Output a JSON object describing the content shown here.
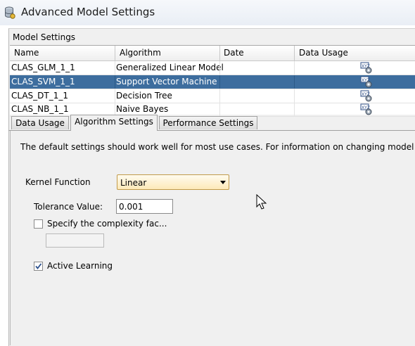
{
  "window": {
    "title": "Advanced Model Settings"
  },
  "model_settings": {
    "section_title": "Model Settings",
    "columns": [
      "Name",
      "Algorithm",
      "Date",
      "Data Usage"
    ],
    "rows": [
      {
        "name": "CLAS_GLM_1_1",
        "algorithm": "Generalized Linear Model",
        "date": "",
        "selected": false
      },
      {
        "name": "CLAS_SVM_1_1",
        "algorithm": "Support Vector Machine",
        "date": "",
        "selected": true
      },
      {
        "name": "CLAS_DT_1_1",
        "algorithm": "Decision Tree",
        "date": "",
        "selected": false
      },
      {
        "name": "CLAS_NB_1_1",
        "algorithm": "Naive Bayes",
        "date": "",
        "selected": false
      }
    ],
    "data_usage_icon": "data-usage-xyz-gear-icon"
  },
  "tabs": [
    {
      "label": "Data Usage",
      "active": false
    },
    {
      "label": "Algorithm Settings",
      "active": true
    },
    {
      "label": "Performance Settings",
      "active": false
    }
  ],
  "algorithm_settings": {
    "info_text": "The default settings should work well for most use cases. For information on changing model algo",
    "kernel_function_label": "Kernel Function",
    "kernel_function_value": "Linear",
    "tolerance_label": "Tolerance Value:",
    "tolerance_value": "0.001",
    "complexity_label": "Specify the complexity fac...",
    "complexity_checked": false,
    "complexity_value": "",
    "active_learning_label": "Active Learning",
    "active_learning_checked": true
  },
  "colors": {
    "selection": "#3d6d9e",
    "dropdown_border": "#c19a4a",
    "panel_bg": "#f0f0f0"
  }
}
